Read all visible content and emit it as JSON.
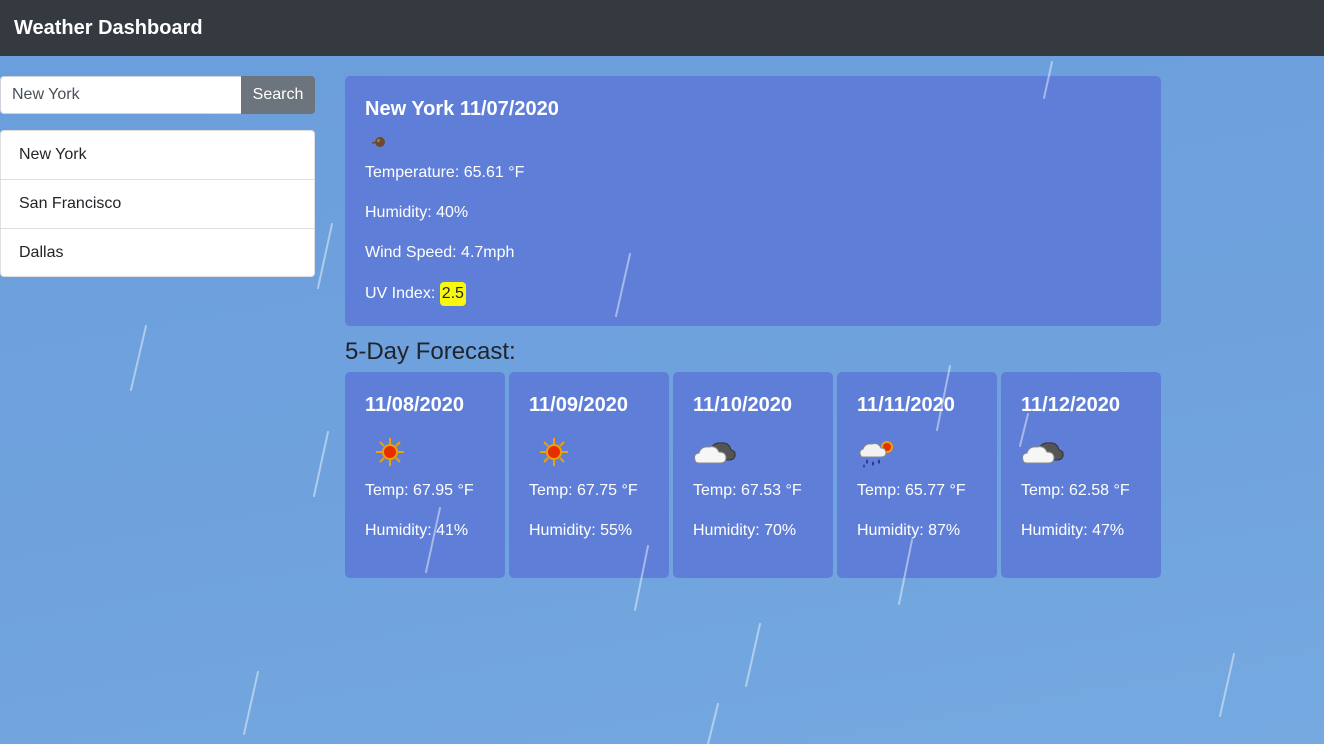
{
  "navbar": {
    "brand": "Weather Dashboard"
  },
  "search": {
    "value": "New York",
    "button_label": "Search"
  },
  "history": [
    {
      "label": "New York"
    },
    {
      "label": "San Francisco"
    },
    {
      "label": "Dallas"
    }
  ],
  "current": {
    "title": "New York 11/07/2020",
    "icon": "clear-night-icon",
    "temperature": "Temperature: 65.61 °F",
    "humidity": "Humidity: 40%",
    "wind": "Wind Speed: 4.7mph",
    "uv_label": "UV Index: ",
    "uv_value": "2.5",
    "uv_color": "#f7f70f"
  },
  "forecast_title": "5-Day Forecast:",
  "forecast": [
    {
      "date": "11/08/2020",
      "icon": "sun-icon",
      "temp": "Temp: 67.95 °F",
      "humidity": "Humidity: 41%"
    },
    {
      "date": "11/09/2020",
      "icon": "sun-icon",
      "temp": "Temp: 67.75 °F",
      "humidity": "Humidity: 55%"
    },
    {
      "date": "11/10/2020",
      "icon": "cloud-icon",
      "temp": "Temp: 67.53 °F",
      "humidity": "Humidity: 70%"
    },
    {
      "date": "11/11/2020",
      "icon": "rain-sun-icon",
      "temp": "Temp: 65.77 °F",
      "humidity": "Humidity: 87%"
    },
    {
      "date": "11/12/2020",
      "icon": "cloud-icon",
      "temp": "Temp: 62.58 °F",
      "humidity": "Humidity: 47%"
    }
  ],
  "colors": {
    "navbar": "#343a40",
    "card": "#5f7ed8",
    "search_button": "#6c757d",
    "background": "#6fa2dd"
  }
}
